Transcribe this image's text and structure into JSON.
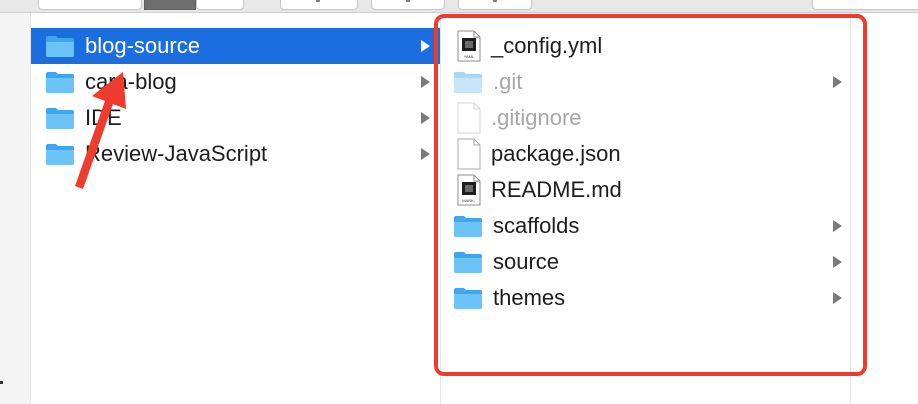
{
  "colors": {
    "selection": "#1b6ee0",
    "folder_blue": "#5bb7f3",
    "annotation_red": "#ef3b2d"
  },
  "column1": {
    "items": [
      {
        "label": "blog-source",
        "icon": "folder-icon",
        "selected": true,
        "has_children": true
      },
      {
        "label": "cara-blog",
        "icon": "folder-icon",
        "selected": false,
        "has_children": true
      },
      {
        "label": "IDE",
        "icon": "folder-icon",
        "selected": false,
        "has_children": true
      },
      {
        "label": "Review-JavaScript",
        "icon": "folder-icon",
        "selected": false,
        "has_children": true
      }
    ]
  },
  "column2": {
    "items": [
      {
        "label": "_config.yml",
        "icon": "yaml-file-icon",
        "dim": false,
        "has_children": false
      },
      {
        "label": ".git",
        "icon": "folder-icon",
        "dim": true,
        "has_children": true
      },
      {
        "label": ".gitignore",
        "icon": "blank-file-icon",
        "dim": true,
        "has_children": false
      },
      {
        "label": "package.json",
        "icon": "blank-file-icon",
        "dim": false,
        "has_children": false
      },
      {
        "label": "README.md",
        "icon": "markdown-file-icon",
        "dim": false,
        "has_children": false
      },
      {
        "label": "scaffolds",
        "icon": "folder-icon",
        "dim": false,
        "has_children": true
      },
      {
        "label": "source",
        "icon": "folder-icon",
        "dim": false,
        "has_children": true
      },
      {
        "label": "themes",
        "icon": "folder-icon",
        "dim": false,
        "has_children": true
      }
    ]
  },
  "icon_badges": {
    "yaml": "YAML",
    "markdown": "MARK↓"
  }
}
